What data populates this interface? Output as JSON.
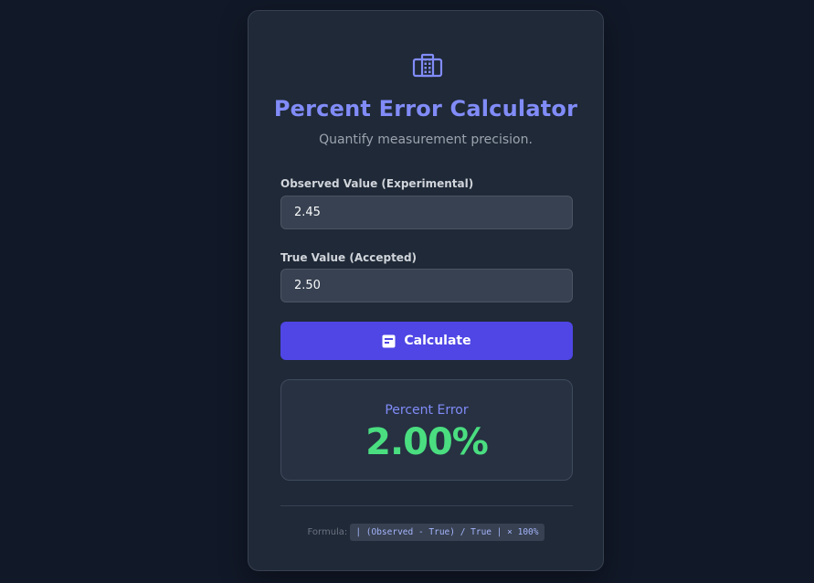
{
  "app": {
    "icon": "calculator-icon",
    "title": "Percent Error Calculator",
    "subtitle": "Quantify measurement precision."
  },
  "form": {
    "observed": {
      "label": "Observed Value (Experimental)",
      "value": "2.45"
    },
    "true_value": {
      "label": "True Value (Accepted)",
      "value": "2.50"
    },
    "calculate_button": {
      "label": "Calculate",
      "icon": "calculator-icon"
    }
  },
  "result": {
    "label": "Percent Error",
    "value": "2.00%"
  },
  "formula": {
    "label": "Formula:",
    "expression": "| (Observed - True) / True | × 100%"
  },
  "colors": {
    "background": "#111827",
    "card": "#1f2937",
    "accent": "#818cf8",
    "button": "#4f46e5",
    "result_value": "#4ade80"
  }
}
